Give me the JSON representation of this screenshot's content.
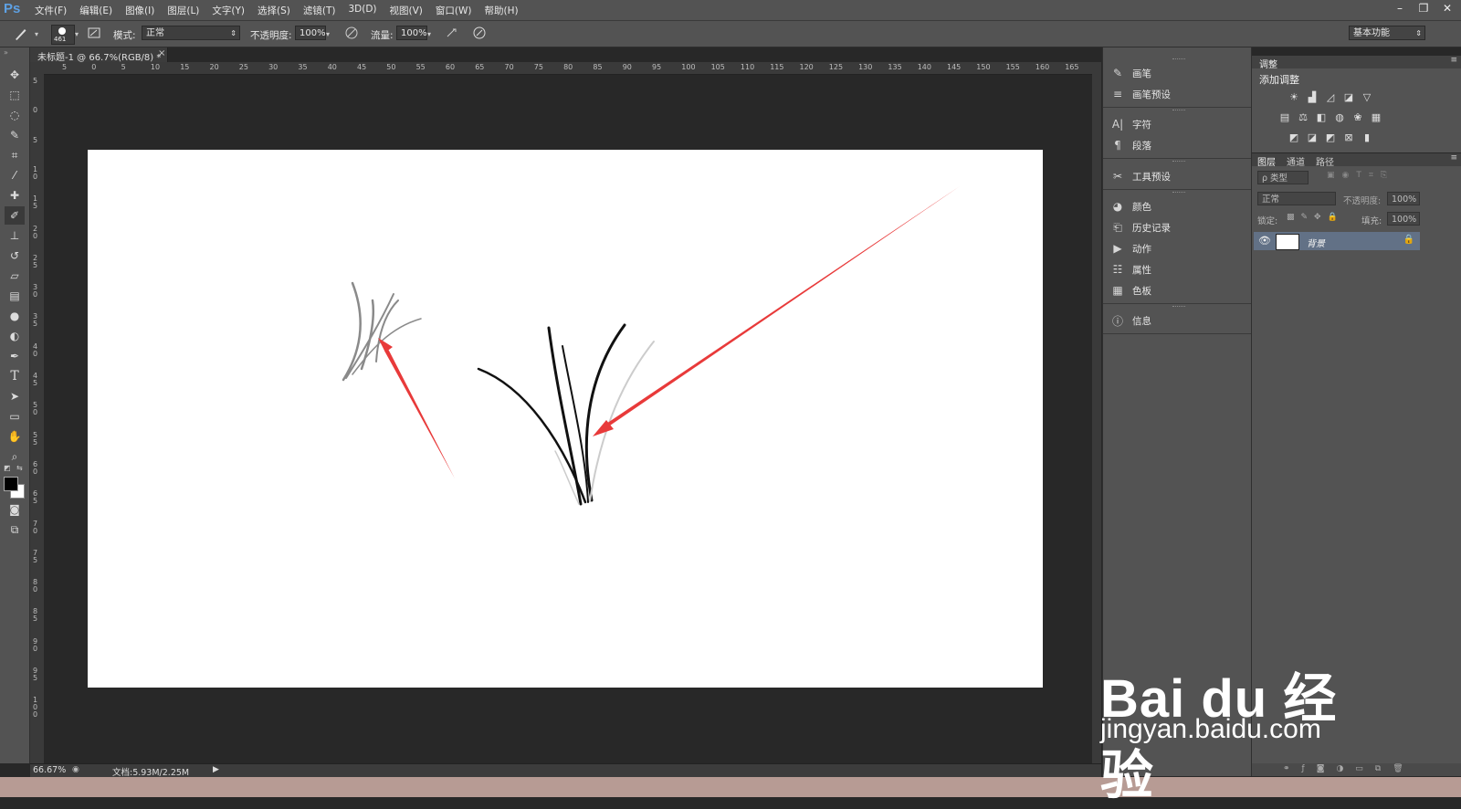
{
  "app": {
    "logo": "Ps"
  },
  "menu": [
    "文件(F)",
    "编辑(E)",
    "图像(I)",
    "图层(L)",
    "文字(Y)",
    "选择(S)",
    "滤镜(T)",
    "3D(D)",
    "视图(V)",
    "窗口(W)",
    "帮助(H)"
  ],
  "window_controls": {
    "minimize": "–",
    "restore": "❐",
    "close": "✕"
  },
  "options": {
    "brush_size": "461",
    "mode_label": "模式:",
    "mode_value": "正常",
    "opacity_label": "不透明度:",
    "opacity_value": "100%",
    "flow_label": "流量:",
    "flow_value": "100%",
    "workspace": "基本功能"
  },
  "document": {
    "tab_title": "未标题-1 @ 66.7%(RGB/8) *",
    "close": "×"
  },
  "ruler_top": [
    "5",
    "0",
    "5",
    "10",
    "15",
    "20",
    "25",
    "30",
    "35",
    "40",
    "45",
    "50",
    "55",
    "60",
    "65",
    "70",
    "75",
    "80",
    "85",
    "90",
    "95",
    "100",
    "105",
    "110",
    "115",
    "120",
    "125",
    "130",
    "135",
    "140",
    "145",
    "150",
    "155",
    "160",
    "165"
  ],
  "ruler_left": [
    "5",
    "0",
    "5",
    "10",
    "15",
    "20",
    "25",
    "30",
    "35",
    "40",
    "45",
    "50",
    "55",
    "60",
    "65",
    "70",
    "75",
    "80",
    "85",
    "90",
    "95",
    "100"
  ],
  "status": {
    "zoom": "66.67%",
    "doc_size": "文档:5.93M/2.25M"
  },
  "dock": {
    "groups": [
      [
        {
          "icon": "brush-icon",
          "label": "画笔"
        },
        {
          "icon": "brush-presets-icon",
          "label": "画笔预设"
        }
      ],
      [
        {
          "icon": "character-icon",
          "label": "字符"
        },
        {
          "icon": "paragraph-icon",
          "label": "段落"
        }
      ],
      [
        {
          "icon": "tool-presets-icon",
          "label": "工具预设"
        }
      ],
      [
        {
          "icon": "color-icon",
          "label": "颜色"
        },
        {
          "icon": "history-icon",
          "label": "历史记录"
        },
        {
          "icon": "actions-icon",
          "label": "动作"
        },
        {
          "icon": "properties-icon",
          "label": "属性"
        },
        {
          "icon": "swatches-icon",
          "label": "色板"
        }
      ],
      [
        {
          "icon": "info-icon",
          "label": "信息"
        }
      ]
    ]
  },
  "adjustments": {
    "tab": "调整",
    "title": "添加调整"
  },
  "layers": {
    "tabs": [
      "图层",
      "通道",
      "路径"
    ],
    "filter_kind": "ρ 类型",
    "blend_mode": "正常",
    "opacity_label": "不透明度:",
    "opacity_value": "100%",
    "lock_label": "锁定:",
    "fill_label": "填充:",
    "fill_value": "100%",
    "layer_name": "背景"
  },
  "watermark": {
    "main": "Bai du 经验",
    "url": "jingyan.baidu.com"
  },
  "colors": {
    "arrow": "#e83a3a",
    "accent": "#5ea1e4",
    "selected_layer": "#627186"
  }
}
